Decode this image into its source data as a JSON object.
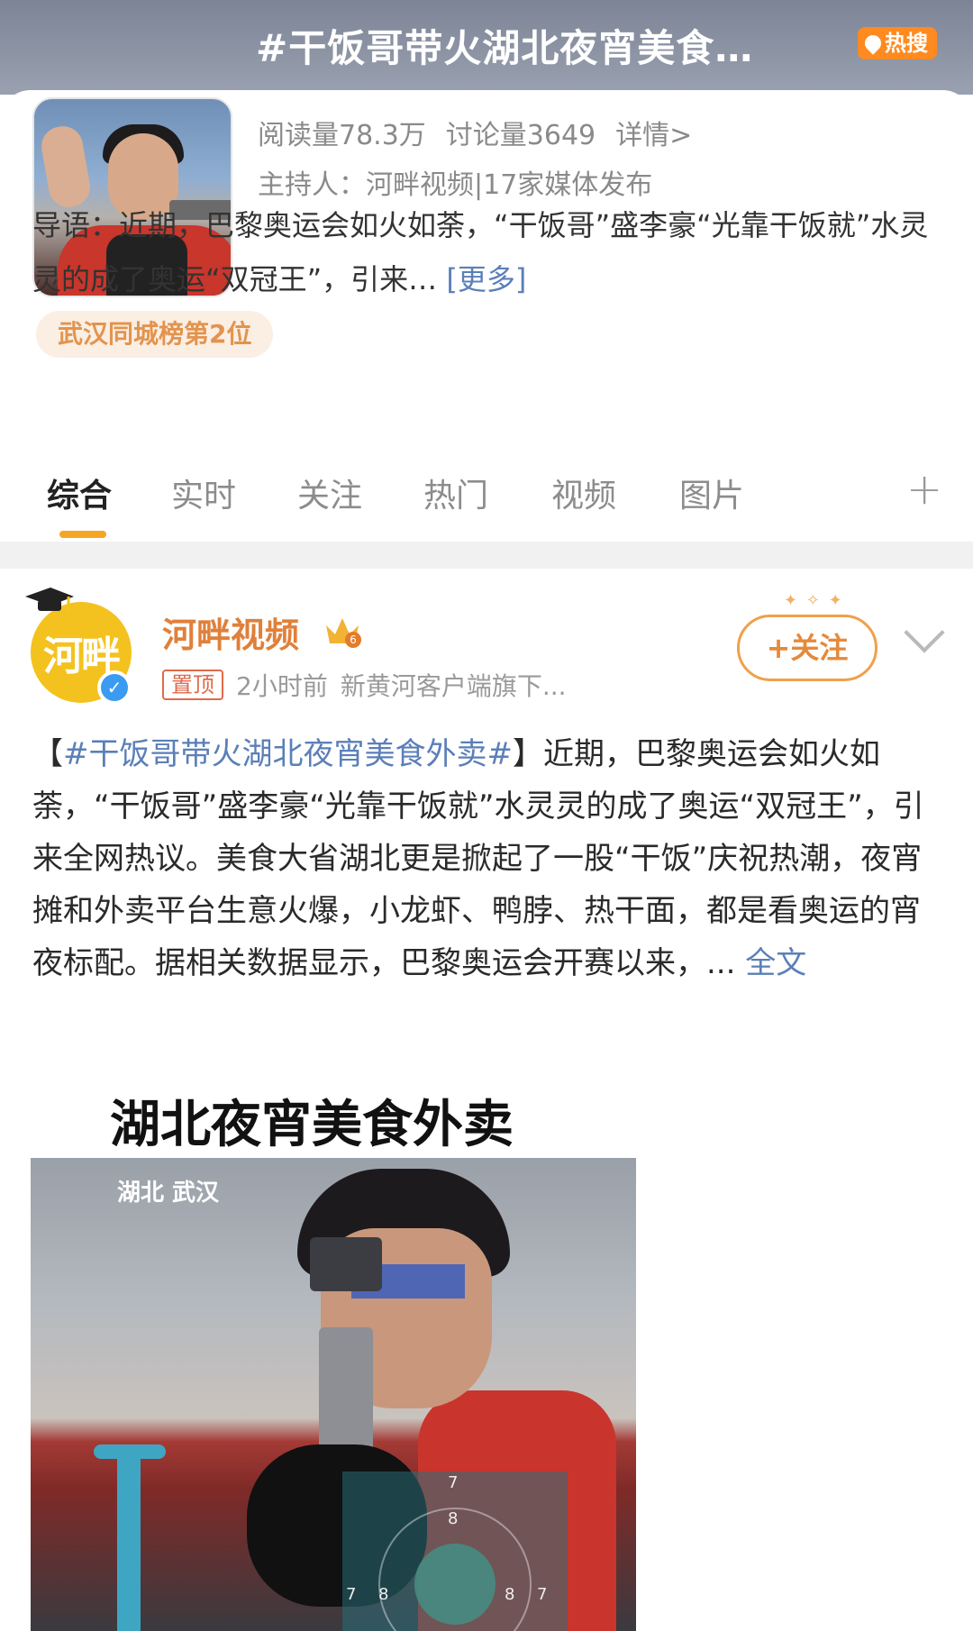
{
  "topic": {
    "title": "#干饭哥带火湖北夜宵美食…",
    "hot_badge": "热搜",
    "reads": "阅读量78.3万",
    "discussions": "讨论量3649",
    "details": "详情>",
    "host": "主持人：河畔视频|17家媒体发布",
    "intro_prefix": "导语：近期，巴黎奥运会如火如荼，“干饭哥”盛李豪“光靠干饭就”水灵灵的成了奥运“双冠王”，引来…",
    "intro_more": "[更多]",
    "rank": "武汉同城榜第2位"
  },
  "tabs": [
    "综合",
    "实时",
    "关注",
    "热门",
    "视频",
    "图片"
  ],
  "tab_plus": "+",
  "post": {
    "author": "河畔视频",
    "avatar_text": "河畔",
    "pinned": "置顶",
    "time": "2小时前",
    "source": "新黄河客户端旗下...",
    "follow": "+关注",
    "text_open": "【",
    "hashtag": "#干饭哥带火湖北夜宵美食外卖#",
    "text_body": "】近期，巴黎奥运会如火如荼，“干饭哥”盛李豪“光靠干饭就”水灵灵的成了奥运“双冠王”，引来全网热议。美食大省湖北更是掀起了一股“干饭”庆祝热潮，夜宵摊和外卖平台生意火爆，小龙虾、鸭脖、热干面，都是看奥运的宵夜标配。据相关数据显示，巴黎奥运会开赛以来，...",
    "full_text": "全文"
  },
  "image": {
    "caption": "湖北夜宵美食外卖",
    "location": "湖北 武汉",
    "target_numbers": [
      "7",
      "8",
      "7",
      "8",
      "8",
      "7"
    ]
  },
  "colors": {
    "accent": "#f5a623",
    "link": "#5b7fb8",
    "author": "#e0803a"
  }
}
